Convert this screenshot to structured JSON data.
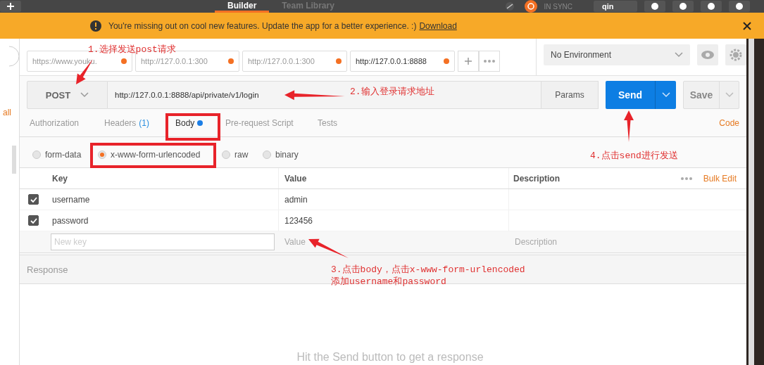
{
  "top_bar": {
    "tabs": [
      {
        "label": "Builder",
        "selected": true
      },
      {
        "label": "Team Library",
        "selected": false
      }
    ],
    "sync_status": "IN SYNC",
    "user": "qin"
  },
  "banner": {
    "message": "You're missing out on cool new features. Update the app for a better experience. :)",
    "link": "Download"
  },
  "sidebar": {
    "link": "all"
  },
  "request_tabs": [
    {
      "url": "https://www.youku.",
      "selected": false,
      "unsaved": true
    },
    {
      "url": "http://127.0.0.1:300",
      "selected": false,
      "unsaved": true
    },
    {
      "url": "http://127.0.0.1:300",
      "selected": false,
      "unsaved": true
    },
    {
      "url": "http://127.0.0.1:8888",
      "selected": true,
      "unsaved": true
    }
  ],
  "environment": {
    "value": "No Environment"
  },
  "request": {
    "method": "POST",
    "url": "http://127.0.0.1:8888/api/private/v1/login",
    "params_button": "Params",
    "send_button": "Send",
    "save_button": "Save"
  },
  "editor_tabs": [
    {
      "label": "Authorization",
      "selected": false,
      "has_content": false
    },
    {
      "label": "Headers",
      "count": "(1)",
      "selected": false,
      "has_content": false
    },
    {
      "label": "Body",
      "selected": true,
      "has_content": true
    },
    {
      "label": "Pre-request Script",
      "selected": false,
      "has_content": false
    },
    {
      "label": "Tests",
      "selected": false,
      "has_content": false
    }
  ],
  "code_link": "Code",
  "body_modes": [
    {
      "label": "form-data",
      "selected": false
    },
    {
      "label": "x-www-form-urlencoded",
      "selected": true
    },
    {
      "label": "raw",
      "selected": false
    },
    {
      "label": "binary",
      "selected": false
    }
  ],
  "table": {
    "columns": [
      "Key",
      "Value",
      "Description"
    ],
    "bulk_edit": "Bulk Edit",
    "rows": [
      {
        "key": "username",
        "value": "admin",
        "checked": true
      },
      {
        "key": "password",
        "value": "123456",
        "checked": true
      }
    ],
    "new_row": {
      "key_placeholder": "New key",
      "value_placeholder": "Value",
      "description_placeholder": "Description"
    }
  },
  "response": {
    "title": "Response",
    "hint": "Hit the Send button to get a response"
  },
  "annotations": [
    {
      "lines": [
        "1.选择发送post请求"
      ]
    },
    {
      "lines": [
        "2.输入登录请求地址"
      ]
    },
    {
      "lines": [
        "3.点击body，点击x-www-form-urlencoded",
        "添加username和password"
      ]
    },
    {
      "lines": [
        "4.点击send进行发送"
      ]
    }
  ]
}
